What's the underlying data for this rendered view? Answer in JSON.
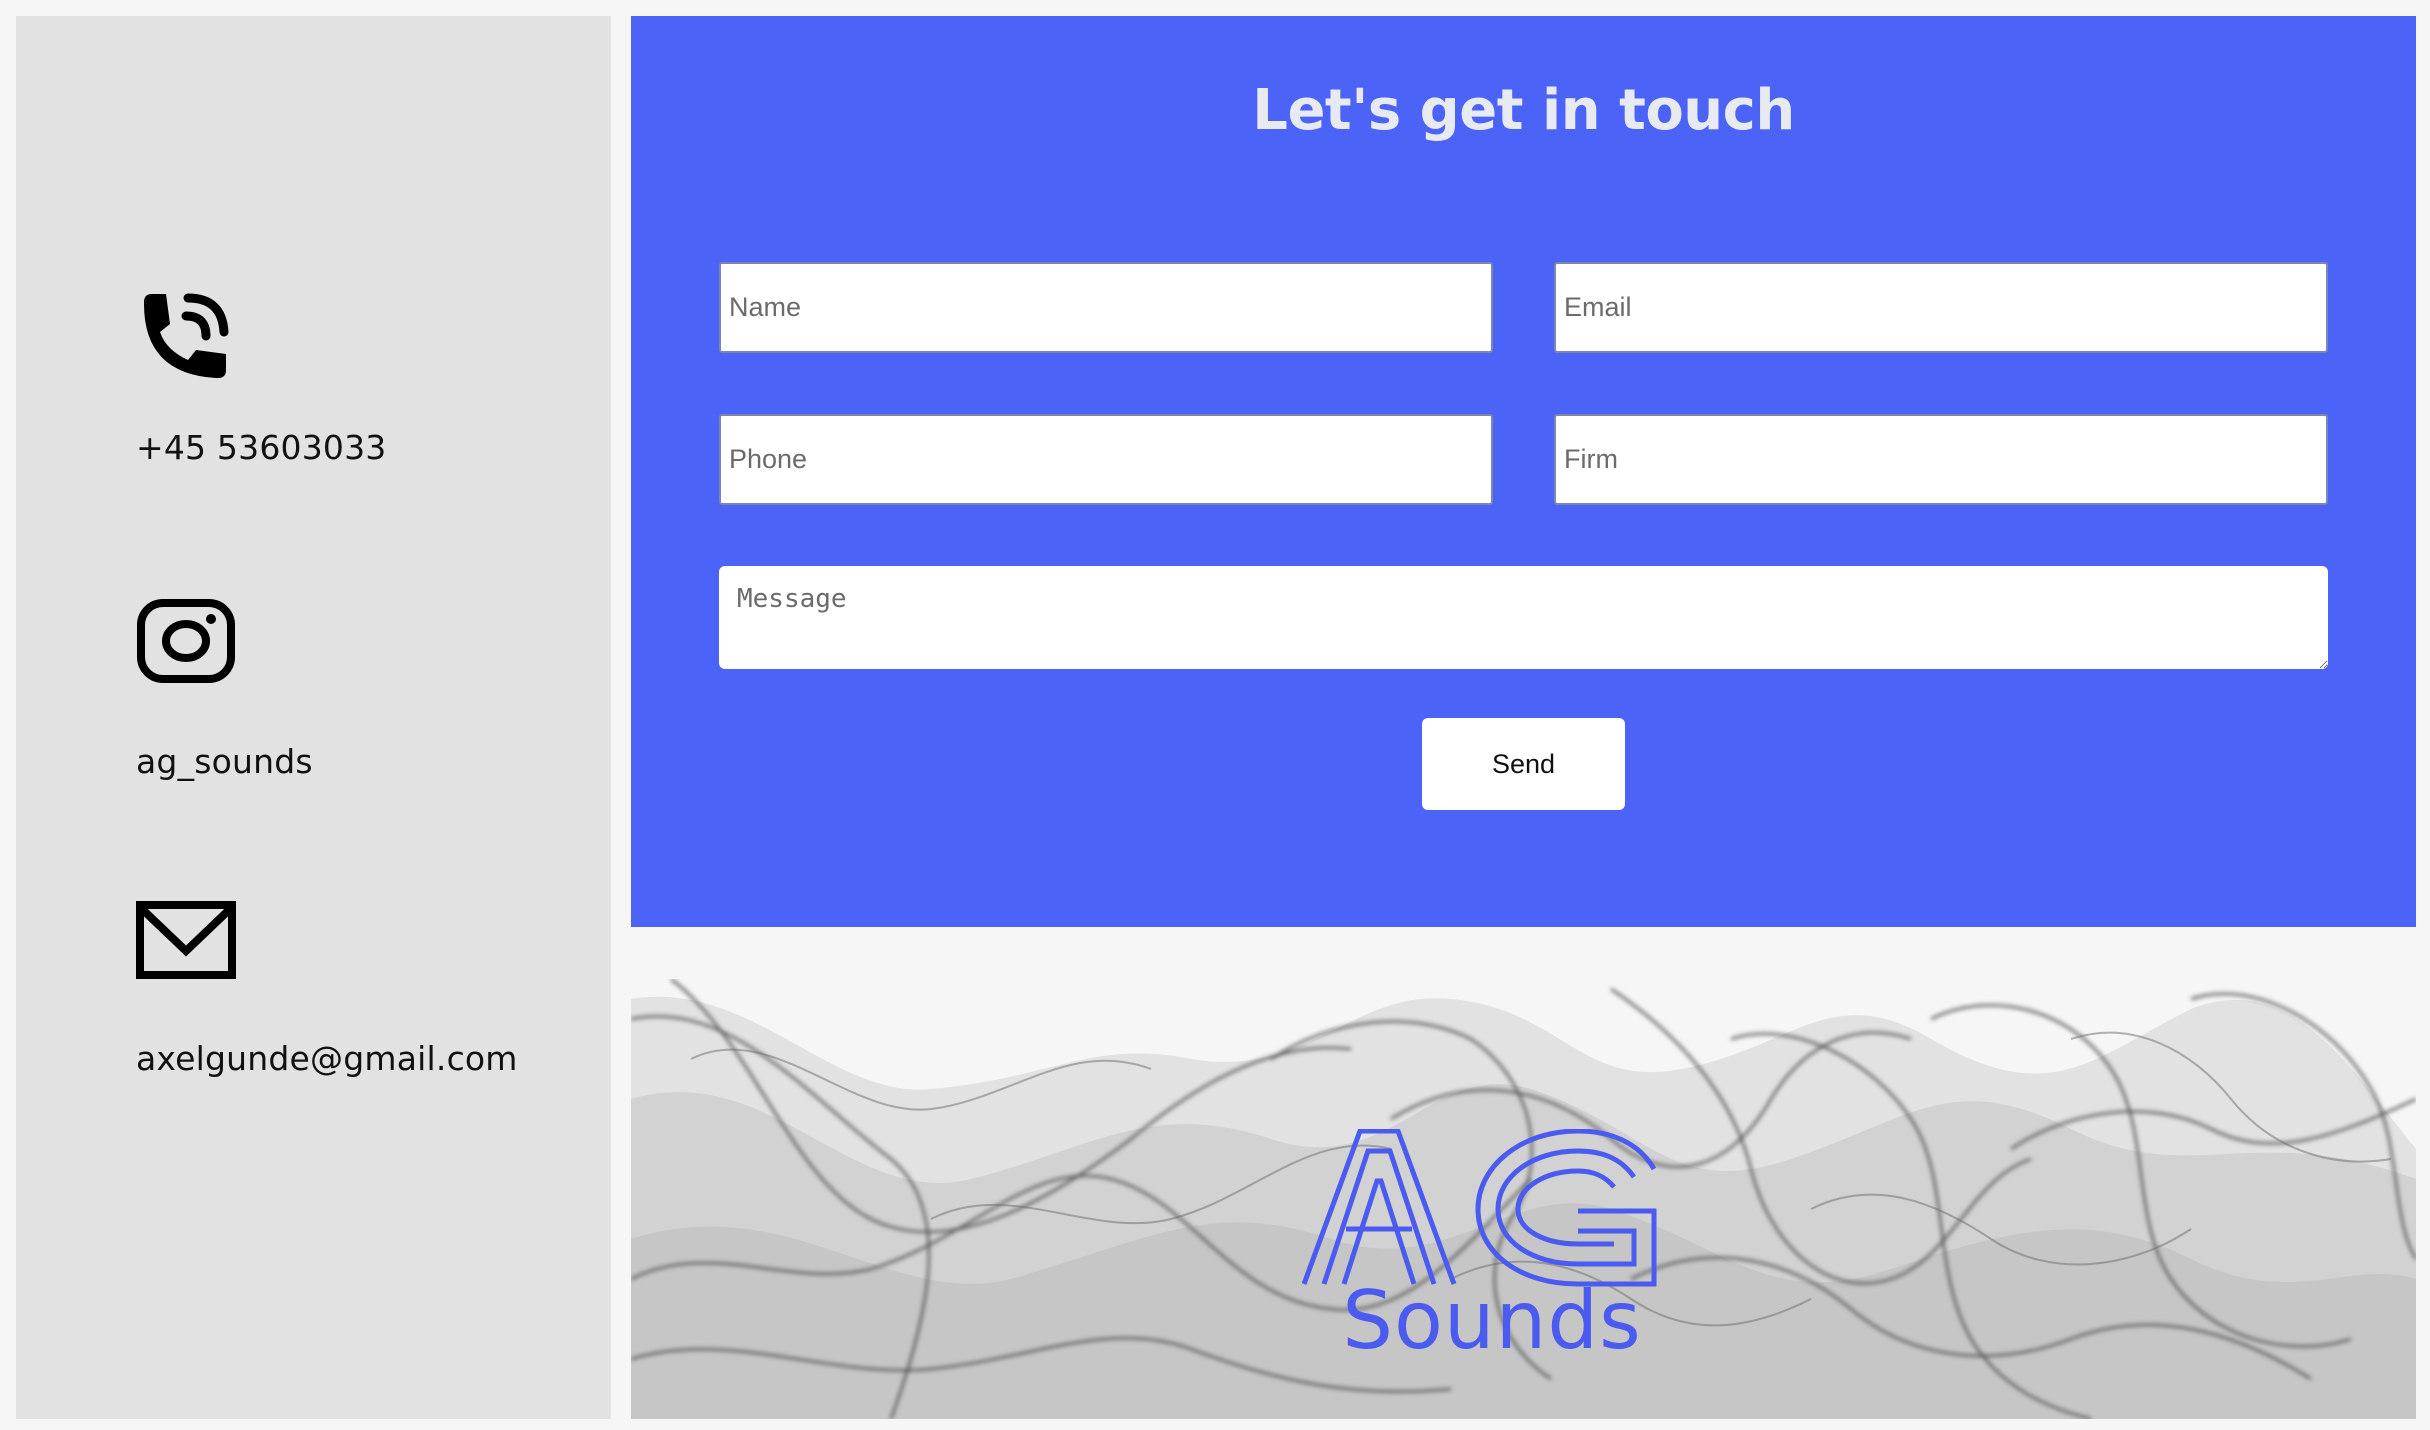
{
  "contact": {
    "phone": "+45 53603033",
    "instagram": "ag_sounds",
    "email": "axelgunde@gmail.com",
    "icons": [
      "phone-icon",
      "instagram-icon",
      "mail-icon"
    ]
  },
  "form": {
    "title": "Let's get in touch",
    "name_placeholder": "Name",
    "email_placeholder": "Email",
    "phone_placeholder": "Phone",
    "firm_placeholder": "Firm",
    "message_placeholder": "Message",
    "send_label": "Send"
  },
  "banner": {
    "logo_letters": "AG",
    "logo_sub": "Sounds"
  },
  "colors": {
    "accent": "#4c63f7",
    "sidebar_bg": "#e2e2e2",
    "logo": "#4b5bf0"
  }
}
